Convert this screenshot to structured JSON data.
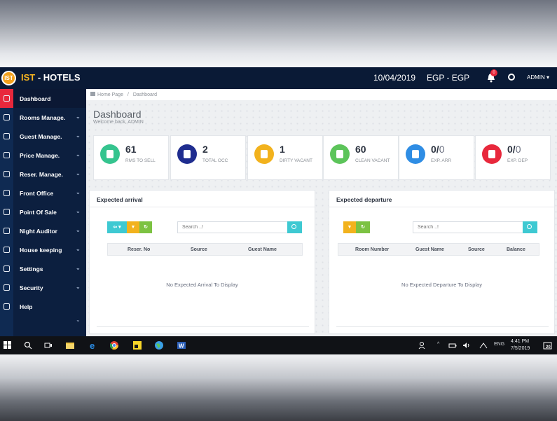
{
  "app": {
    "brand_prefix": "IST",
    "brand_sep": " - ",
    "brand_suffix": "HOTELS",
    "logo_text": "IST",
    "date": "10/04/2019",
    "currency": "EGP - EGP",
    "notification_count": "0",
    "user": "ADMIN ▾"
  },
  "sidebar": {
    "items": [
      {
        "label": "Dashboard",
        "icon": "dashboard-icon",
        "active": true
      },
      {
        "label": "Rooms Manage.",
        "icon": "rooms-icon"
      },
      {
        "label": "Guest Manage.",
        "icon": "guests-icon"
      },
      {
        "label": "Price Manage.",
        "icon": "price-icon"
      },
      {
        "label": "Reser. Manage.",
        "icon": "reservation-icon"
      },
      {
        "label": "Front Office",
        "icon": "monitor-icon"
      },
      {
        "label": "Point Of Sale",
        "icon": "cart-icon"
      },
      {
        "label": "Night Auditor",
        "icon": "auditor-icon"
      },
      {
        "label": "House keeping",
        "icon": "home-icon"
      },
      {
        "label": "Settings",
        "icon": "gear-icon"
      },
      {
        "label": "Security",
        "icon": "lock-icon"
      },
      {
        "label": "Help",
        "icon": "help-icon"
      }
    ],
    "chevron": "⌄"
  },
  "breadcrumb": {
    "home": "Home Page",
    "sep": "/",
    "current": "Dashboard"
  },
  "page": {
    "title": "Dashboard",
    "subtitle": "Welcome back, ADMIN"
  },
  "stats": [
    {
      "value": "61",
      "denominator": "",
      "label": "RMS TO SELL",
      "color": "#35c48f"
    },
    {
      "value": "2",
      "denominator": "",
      "label": "TOTAL OCC",
      "color": "#1f2d8f"
    },
    {
      "value": "1",
      "denominator": "",
      "label": "DIRTY VACANT",
      "color": "#f2b21d"
    },
    {
      "value": "60",
      "denominator": "",
      "label": "CLEAN VACANT",
      "color": "#5cc45a"
    },
    {
      "value": "0/",
      "denominator": "0",
      "label": "EXP. ARR",
      "color": "#2f8de4"
    },
    {
      "value": "0/",
      "denominator": "0",
      "label": "EXP. DEP",
      "color": "#e8283c"
    }
  ],
  "arrival": {
    "title": "Expected arrival",
    "export_btn": "⇦ ▾",
    "filter_btn": "▼",
    "refresh_btn": "↻",
    "search_placeholder": "Search ..!",
    "columns": [
      "Reser. No",
      "Source",
      "Guest Name"
    ],
    "empty": "No Expected Arrival To Display"
  },
  "departure": {
    "title": "Expected departure",
    "filter_btn": "▼",
    "refresh_btn": "↻",
    "search_placeholder": "Search ..!",
    "columns": [
      "Room Number",
      "Guest Name",
      "Source",
      "Balance"
    ],
    "empty": "No Expected Departure To Display"
  },
  "taskbar": {
    "lang": "ENG",
    "time": "4:41 PM",
    "date": "7/5/2019",
    "notif": "20"
  }
}
